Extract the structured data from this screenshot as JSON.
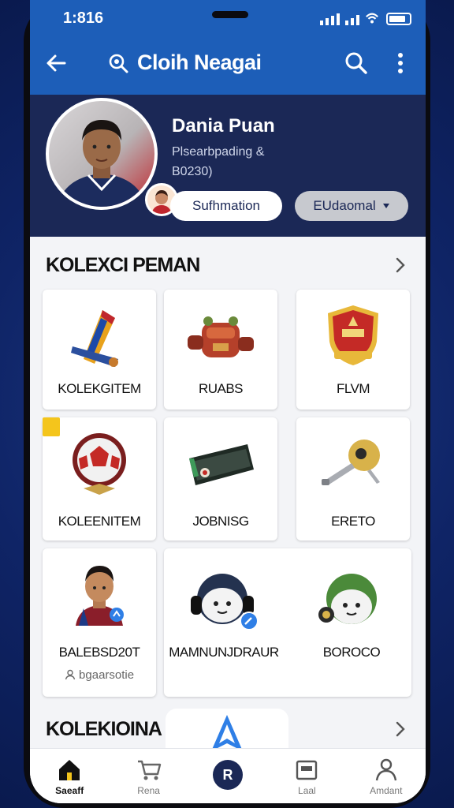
{
  "status": {
    "time": "1:816"
  },
  "appbar": {
    "title": "Cloih Neagai",
    "back_icon": "arrow-left-icon",
    "search_icon": "search-icon",
    "more_icon": "more-vertical-icon"
  },
  "profile": {
    "name": "Dania Puan",
    "subtitle_1": "Plsearbpading &",
    "subtitle_2": "B0230)",
    "subscribe_label": "Sufhmation",
    "dropdown_label": "EUdaomal"
  },
  "section_1": {
    "title": "KOLEXCI PEMAN",
    "items": [
      {
        "label": "KOLEKGITEM",
        "icon": "flag-pennant-icon"
      },
      {
        "label": "RUABS",
        "icon": "backpack-cannon-icon"
      },
      {
        "label": "FLVM",
        "icon": "shield-crest-icon"
      },
      {
        "label": "KOLEENITEM",
        "icon": "soccer-ball-medal-icon"
      },
      {
        "label": "JOBNISG",
        "icon": "wristband-icon"
      },
      {
        "label": "ERETO",
        "icon": "key-icon"
      },
      {
        "label": "BALEBSD20T",
        "sub": "bgaarsotie",
        "icon": "player-avatar-icon"
      },
      {
        "label": "MAMNUNJDRAUR",
        "icon": "headphone-character-icon"
      },
      {
        "label": "BOROCO",
        "icon": "helmet-character-icon"
      }
    ]
  },
  "section_2": {
    "title": "KOLEKIOINA"
  },
  "nav": {
    "items": [
      {
        "label": "Saeaff",
        "icon": "home-icon"
      },
      {
        "label": "Rena",
        "icon": "cart-icon"
      },
      {
        "label": "",
        "icon": "center-badge-icon"
      },
      {
        "label": "Laal",
        "icon": "inbox-icon"
      },
      {
        "label": "Amdant",
        "icon": "user-icon"
      }
    ],
    "center_glyph": "R"
  },
  "colors": {
    "appbar": "#1d5eb8",
    "profile_bg": "#1b2856",
    "accent": "#2f7fe6"
  }
}
